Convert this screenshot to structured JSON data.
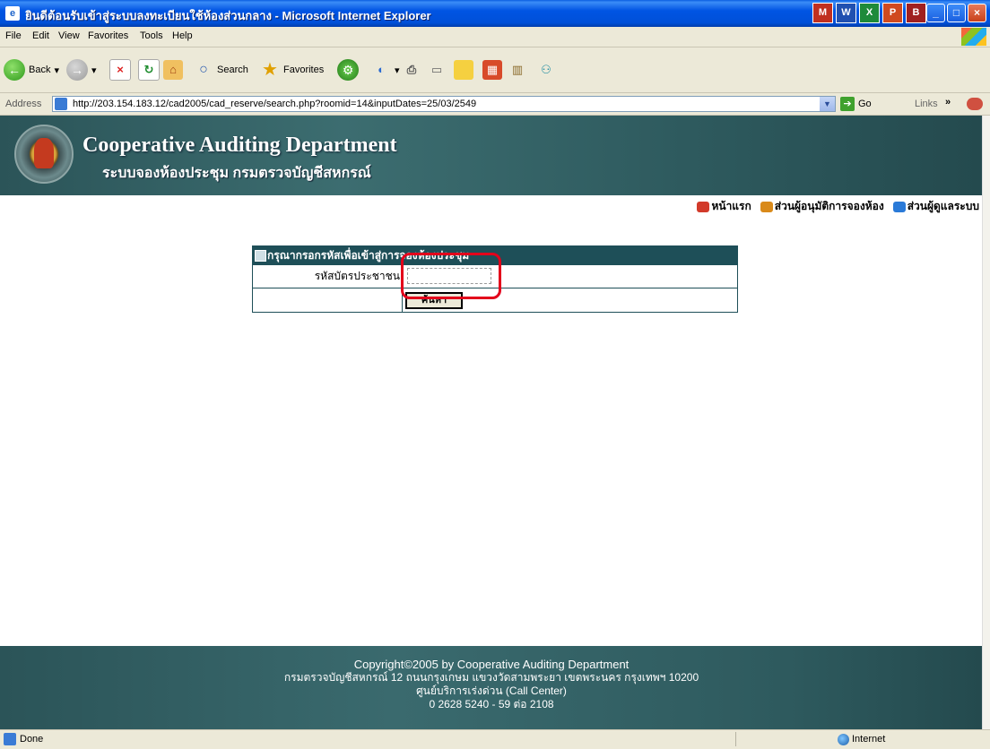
{
  "window": {
    "title": "ยินดีต้อนรับเข้าสู่ระบบลงทะเบียนใช้ห้องส่วนกลาง - Microsoft Internet Explorer",
    "tray_icons": [
      "M",
      "W",
      "X",
      "P",
      "B"
    ]
  },
  "menu": {
    "items": [
      "File",
      "Edit",
      "View",
      "Favorites",
      "Tools",
      "Help"
    ]
  },
  "toolbar": {
    "back": "Back",
    "search": "Search",
    "favorites": "Favorites"
  },
  "address": {
    "label": "Address",
    "url": "http://203.154.183.12/cad2005/cad_reserve/search.php?roomid=14&inputDates=25/03/2549",
    "go": "Go",
    "links": "Links"
  },
  "site": {
    "title": "Cooperative Auditing Department",
    "subtitle": "ระบบจองห้องประชุม กรมตรวจบัญชีสหกรณ์"
  },
  "nav": {
    "items": [
      "หน้าแรก",
      "ส่วนผู้อนุมัติการจองห้อง",
      "ส่วนผู้ดูแลระบบ"
    ],
    "colors": [
      "#d23a2a",
      "#d98a1a",
      "#2a7ad8"
    ]
  },
  "form": {
    "header": "กรุณากรอกรหัสเพื่อเข้าสู่การจองห้องประชุม",
    "id_label": "รหัสบัตรประชาชน",
    "id_value": "",
    "search_button": "ค้นหา"
  },
  "footer": {
    "copyright": "Copyright©2005 by Cooperative Auditing Department",
    "address": "กรมตรวจบัญชีสหกรณ์ 12 ถนนกรุงเกษม แขวงวัดสามพระยา เขตพระนคร กรุงเทพฯ 10200",
    "callcenter": "ศูนย์บริการเร่งด่วน (Call Center)",
    "phone": "0 2628 5240 - 59 ต่อ 2108"
  },
  "status": {
    "text": "Done",
    "zone": "Internet"
  }
}
